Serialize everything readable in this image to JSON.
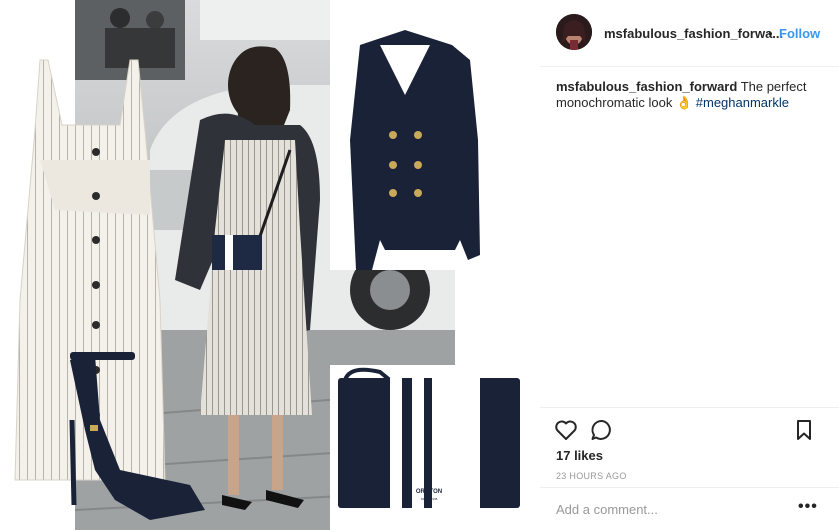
{
  "post": {
    "username": "msfabulous_fashion_forwa...",
    "separator": "•",
    "follow_label": "Follow",
    "caption_user": "msfabulous_fashion_forward",
    "caption_text": " The perfect monochromatic look ",
    "caption_emoji": "👌",
    "caption_hashtag": "#meghanmarkle",
    "likes": "17 likes",
    "timestamp": "23 HOURS AGO",
    "comment_placeholder": "Add a comment...",
    "more_label": "•••"
  },
  "image": {
    "bag_brand": "OROTON",
    "bag_subtext": "SINCE 1938"
  },
  "icons": {
    "like": "heart-icon",
    "comment": "comment-icon",
    "save": "bookmark-icon",
    "options": "more-options-icon"
  },
  "colors": {
    "follow": "#3897f0",
    "hashtag": "#003569",
    "navy": "#1a2238",
    "muted": "#999999"
  }
}
